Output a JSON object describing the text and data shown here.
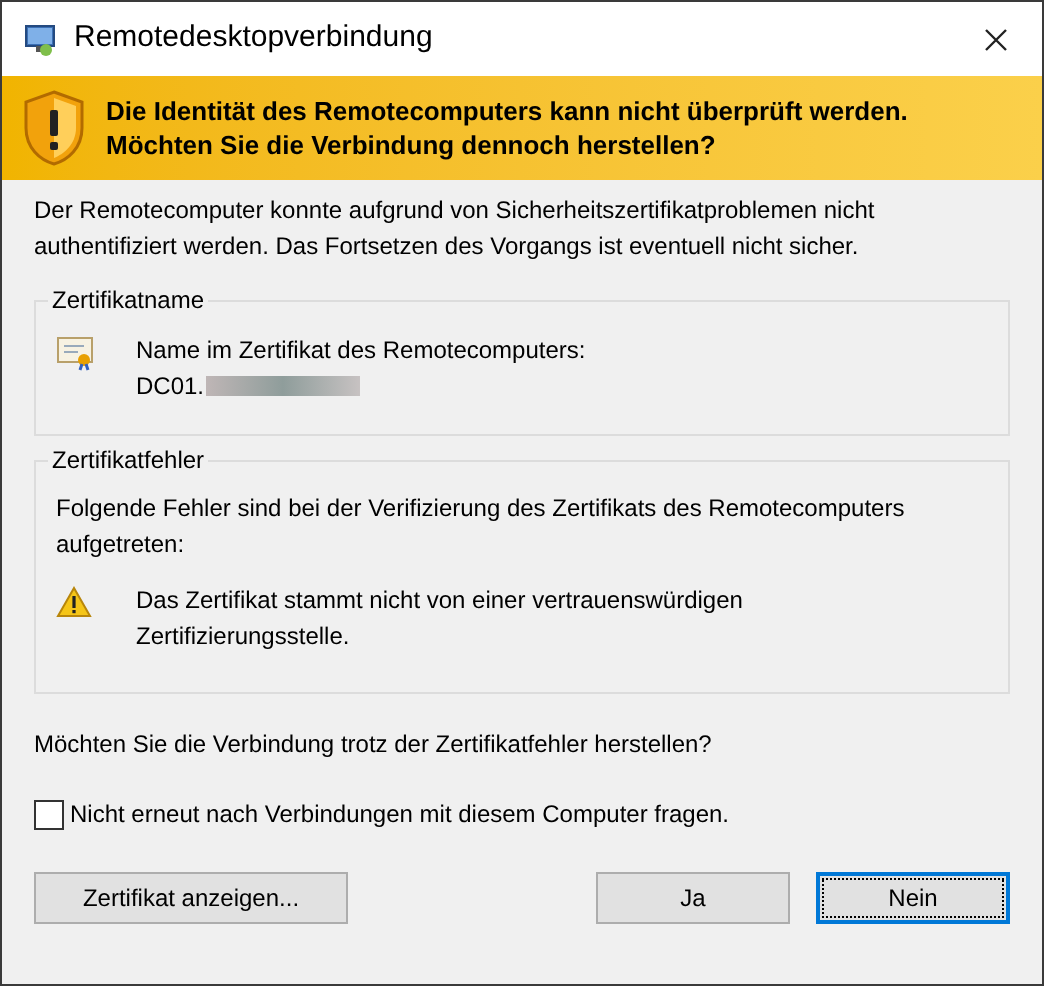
{
  "window": {
    "title": "Remotedesktopverbindung"
  },
  "banner": {
    "lines": [
      "Die Identität des Remotecomputers kann nicht überprüft werden.",
      "Möchten Sie die Verbindung dennoch herstellen?"
    ]
  },
  "intro": "Der Remotecomputer konnte aufgrund von Sicherheitszertifikatproblemen nicht authentifiziert werden. Das Fortsetzen des Vorgangs ist eventuell nicht sicher.",
  "certificate_name": {
    "legend": "Zertifikatname",
    "label": "Name im Zertifikat des Remotecomputers:",
    "value": "DC01."
  },
  "certificate_errors": {
    "legend": "Zertifikatfehler",
    "description": "Folgende Fehler sind bei der Verifizierung des Zertifikats des Remotecomputers aufgetreten:",
    "errors": [
      "Das Zertifikat stammt nicht von einer vertrauenswürdigen Zertifizierungsstelle."
    ]
  },
  "question": "Möchten Sie die Verbindung trotz der Zertifikatfehler herstellen?",
  "dont_ask": {
    "label": "Nicht erneut nach Verbindungen mit diesem Computer fragen.",
    "checked": false
  },
  "buttons": [
    {
      "label": "Zertifikat anzeigen...",
      "focused": false
    },
    {
      "label": "Ja",
      "focused": false
    },
    {
      "label": "Nein",
      "focused": true
    }
  ]
}
